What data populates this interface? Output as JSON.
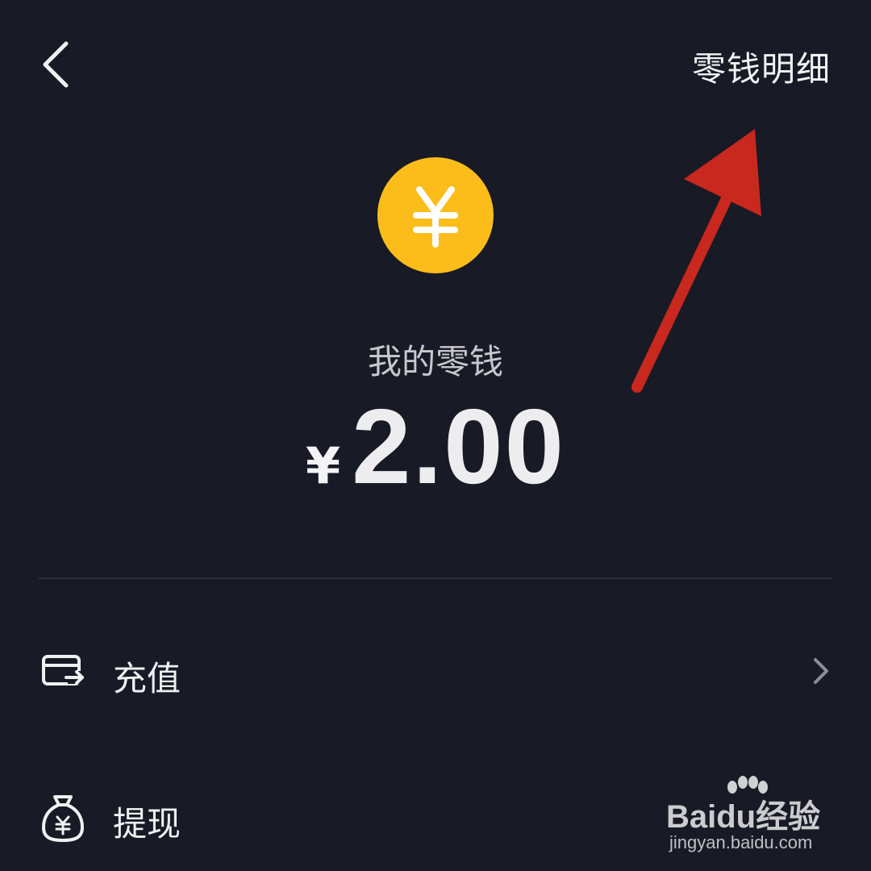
{
  "header": {
    "back_icon": "chevron-left-icon",
    "detail_link_label": "零钱明细"
  },
  "wallet": {
    "coin_icon": "yuan-coin-icon",
    "coin_color": "#fcbd1b",
    "balance_label": "我的零钱",
    "currency_symbol": "¥",
    "amount": "2.00"
  },
  "menu": {
    "items": [
      {
        "icon": "card-transfer-icon",
        "label": "充值",
        "chevron": "chevron-right-icon"
      },
      {
        "icon": "money-bag-icon",
        "label": "提现"
      }
    ]
  },
  "annotation": {
    "arrow_color": "#c8281e"
  },
  "watermark": {
    "logo_text_latin": "Bai",
    "logo_text_paw": "du",
    "logo_text_cn": "经验",
    "url": "jingyan.baidu.com"
  },
  "theme": {
    "background": "#181a25",
    "divider": "#2d303b"
  }
}
